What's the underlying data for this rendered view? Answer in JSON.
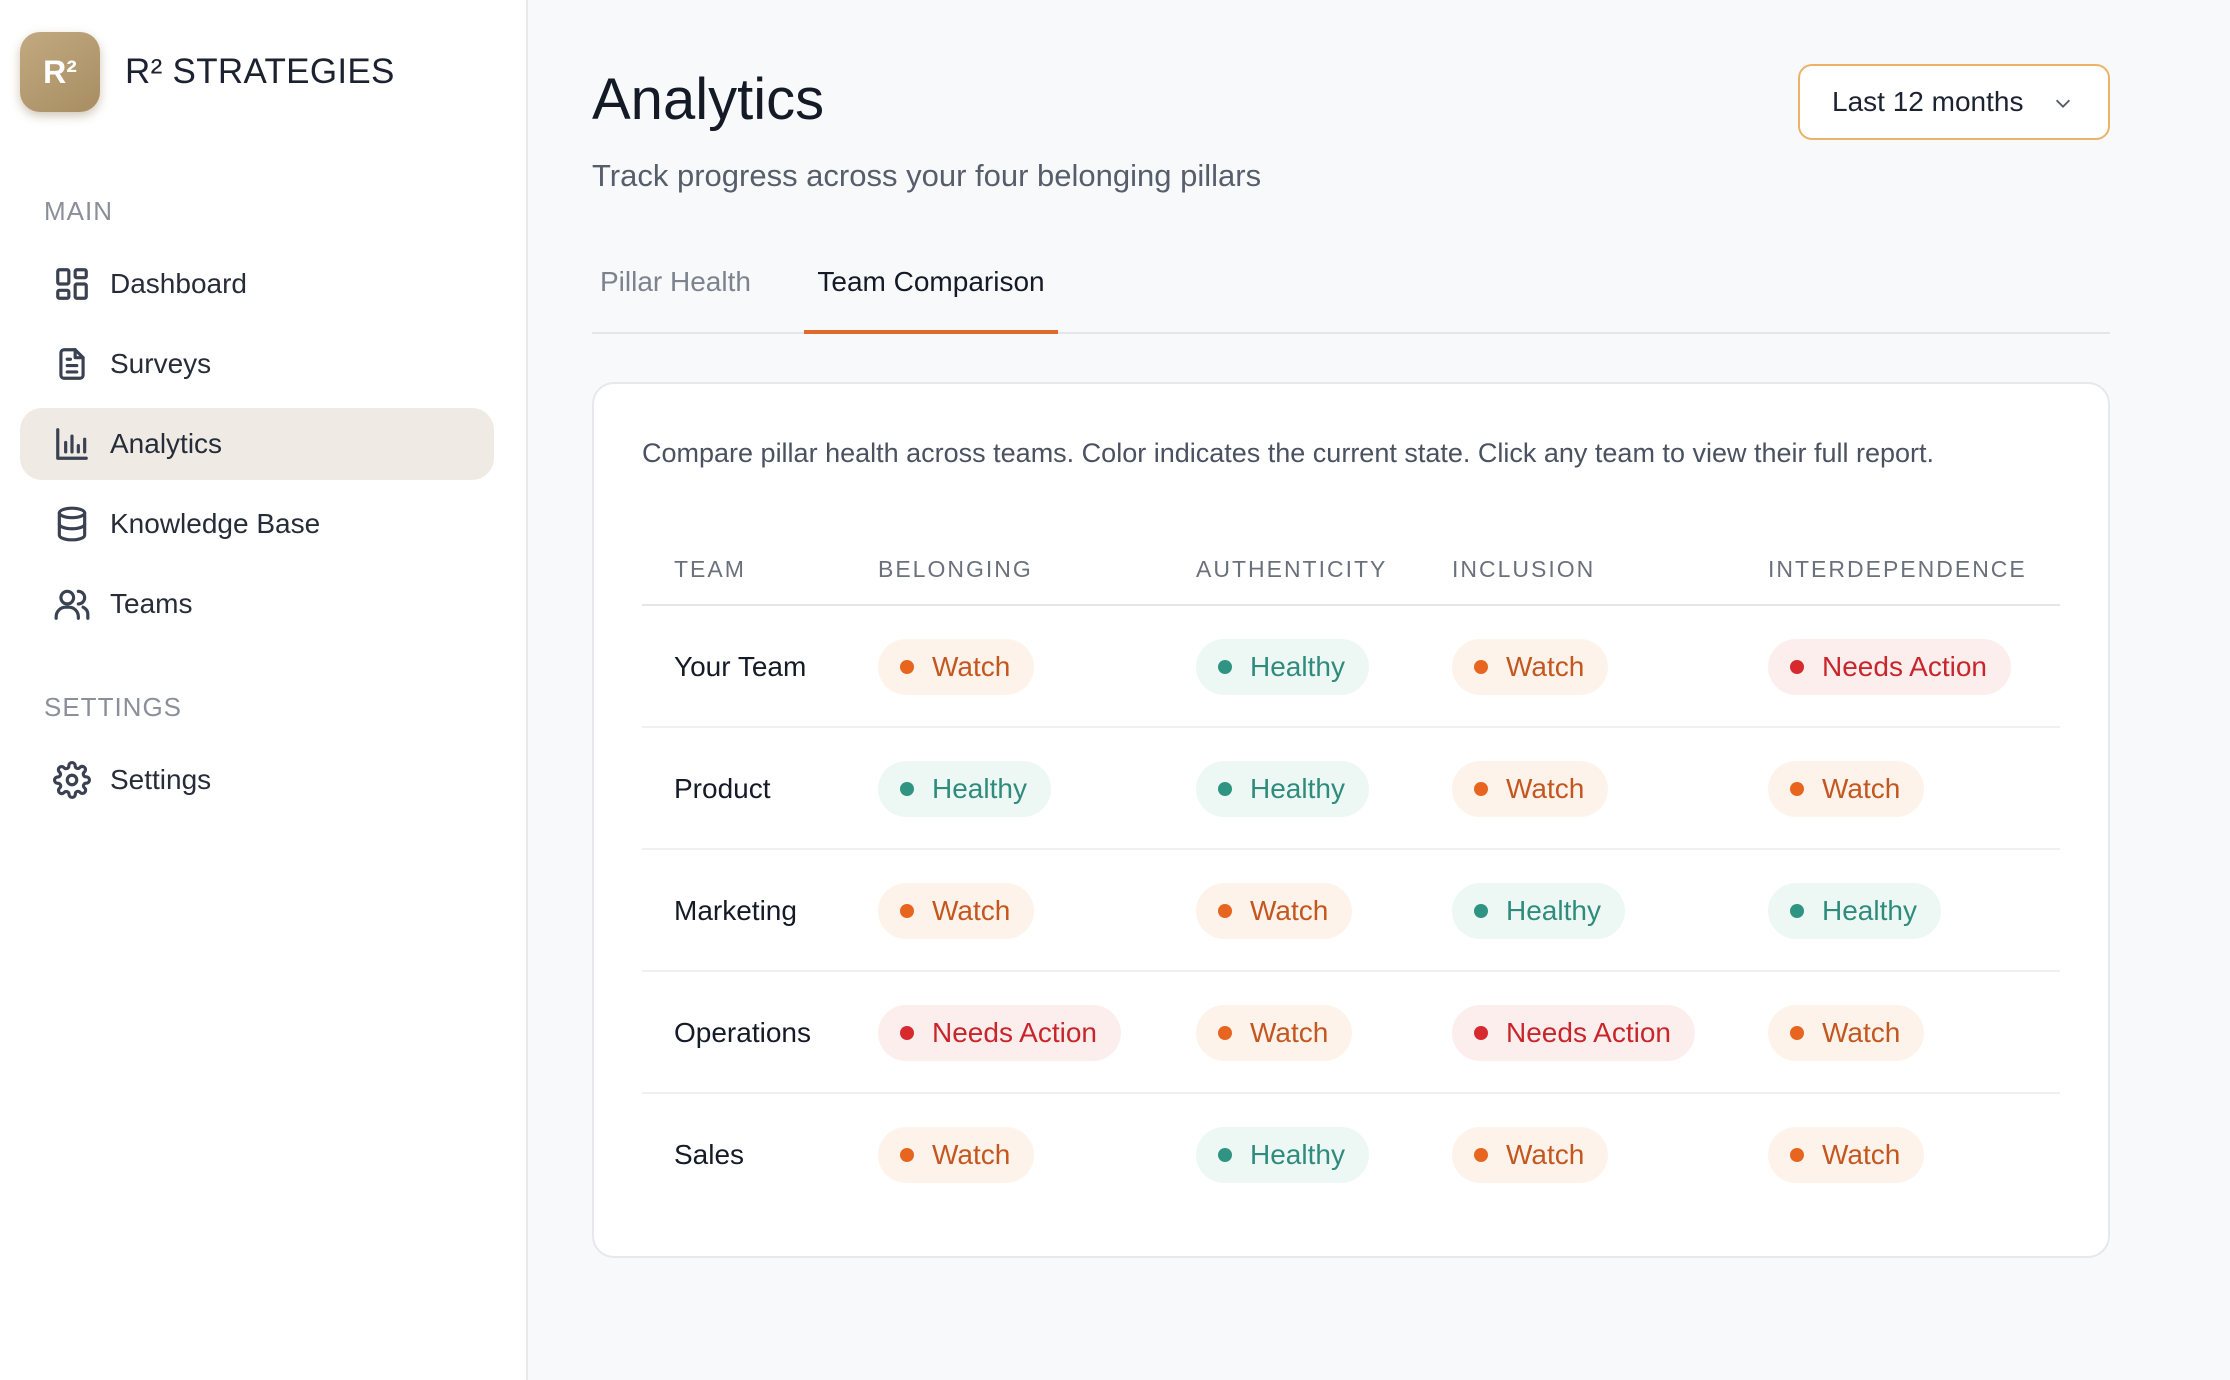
{
  "brand": {
    "logo_text": "R²",
    "name": "R² STRATEGIES"
  },
  "sidebar": {
    "sections": [
      {
        "label": "MAIN"
      },
      {
        "label": "SETTINGS"
      }
    ],
    "items": [
      {
        "label": "Dashboard",
        "icon": "dashboard-icon"
      },
      {
        "label": "Surveys",
        "icon": "document-icon"
      },
      {
        "label": "Analytics",
        "icon": "bar-chart-icon",
        "active": true
      },
      {
        "label": "Knowledge Base",
        "icon": "database-icon"
      },
      {
        "label": "Teams",
        "icon": "users-icon"
      },
      {
        "label": "Settings",
        "icon": "gear-icon"
      }
    ]
  },
  "header": {
    "title": "Analytics",
    "subtitle": "Track progress across your four belonging pillars",
    "range_select": {
      "value": "Last 12 months"
    }
  },
  "tabs": [
    {
      "label": "Pillar Health",
      "active": false
    },
    {
      "label": "Team Comparison",
      "active": true
    }
  ],
  "comparison": {
    "description": "Compare pillar health across teams. Color indicates the current state. Click any team to view their full report.",
    "columns": [
      "TEAM",
      "BELONGING",
      "AUTHENTICITY",
      "INCLUSION",
      "INTERDEPENDENCE"
    ],
    "rows": [
      {
        "team": "Your Team",
        "cells": [
          {
            "label": "Watch",
            "state": "watch"
          },
          {
            "label": "Healthy",
            "state": "healthy"
          },
          {
            "label": "Watch",
            "state": "watch"
          },
          {
            "label": "Needs Action",
            "state": "needs"
          }
        ]
      },
      {
        "team": "Product",
        "cells": [
          {
            "label": "Healthy",
            "state": "healthy"
          },
          {
            "label": "Healthy",
            "state": "healthy"
          },
          {
            "label": "Watch",
            "state": "watch"
          },
          {
            "label": "Watch",
            "state": "watch"
          }
        ]
      },
      {
        "team": "Marketing",
        "cells": [
          {
            "label": "Watch",
            "state": "watch"
          },
          {
            "label": "Watch",
            "state": "watch"
          },
          {
            "label": "Healthy",
            "state": "healthy"
          },
          {
            "label": "Healthy",
            "state": "healthy"
          }
        ]
      },
      {
        "team": "Operations",
        "cells": [
          {
            "label": "Needs Action",
            "state": "needs"
          },
          {
            "label": "Watch",
            "state": "watch"
          },
          {
            "label": "Needs Action",
            "state": "needs"
          },
          {
            "label": "Watch",
            "state": "watch"
          }
        ]
      },
      {
        "team": "Sales",
        "cells": [
          {
            "label": "Watch",
            "state": "watch"
          },
          {
            "label": "Healthy",
            "state": "healthy"
          },
          {
            "label": "Watch",
            "state": "watch"
          },
          {
            "label": "Watch",
            "state": "watch"
          }
        ]
      }
    ]
  },
  "colors": {
    "accent": "#e06a2a",
    "watch": "#e8651f",
    "healthy": "#2f9482",
    "needs_action": "#d72a2f",
    "brand": "#b39a70"
  }
}
